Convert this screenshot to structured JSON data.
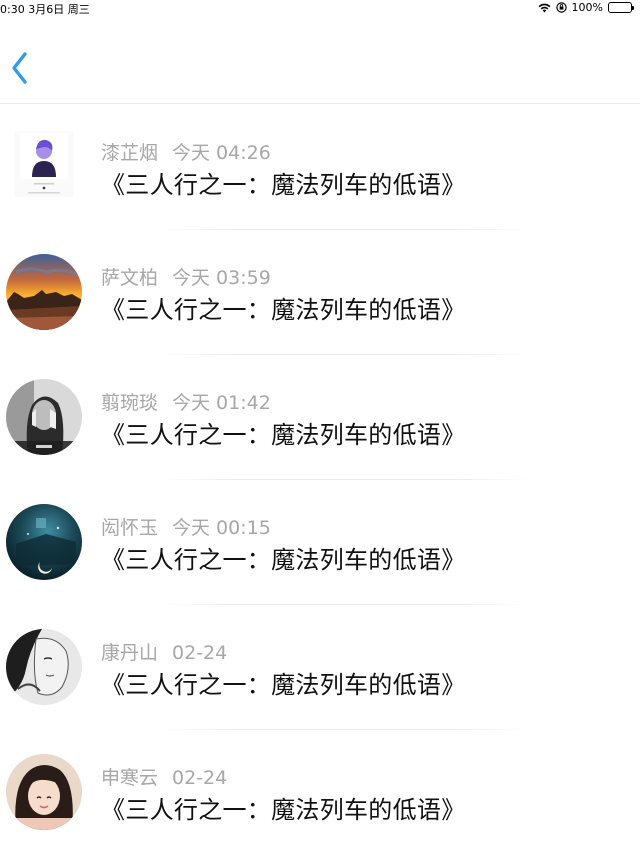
{
  "status_bar": {
    "time_date": "0:30  3月6日 周三",
    "battery_percent": "100%",
    "wifi_icon": "wifi-icon",
    "lock_icon": "orientation-lock-icon",
    "battery_icon": "battery-icon"
  },
  "nav": {
    "back_icon": "chevron-left-icon",
    "accent_color": "#2f9bea"
  },
  "items": [
    {
      "name": "漆芷烟",
      "time": "今天 04:26",
      "title": "《三人行之一：魔法列车的低语》",
      "avatar": "poster-figure"
    },
    {
      "name": "萨文柏",
      "time": "今天 03:59",
      "title": "《三人行之一：魔法列车的低语》",
      "avatar": "sunset-landscape"
    },
    {
      "name": "翦琬琰",
      "time": "今天 01:42",
      "title": "《三人行之一：魔法列车的低语》",
      "avatar": "grayscale-portrait"
    },
    {
      "name": "闳怀玉",
      "time": "今天 00:15",
      "title": "《三人行之一：魔法列车的低语》",
      "avatar": "night-moon"
    },
    {
      "name": "康丹山",
      "time": "02-24",
      "title": "《三人行之一：魔法列车的低语》",
      "avatar": "sketch-face"
    },
    {
      "name": "申寒云",
      "time": "02-24",
      "title": "《三人行之一：魔法列车的低语》",
      "avatar": "girl-photo"
    }
  ]
}
